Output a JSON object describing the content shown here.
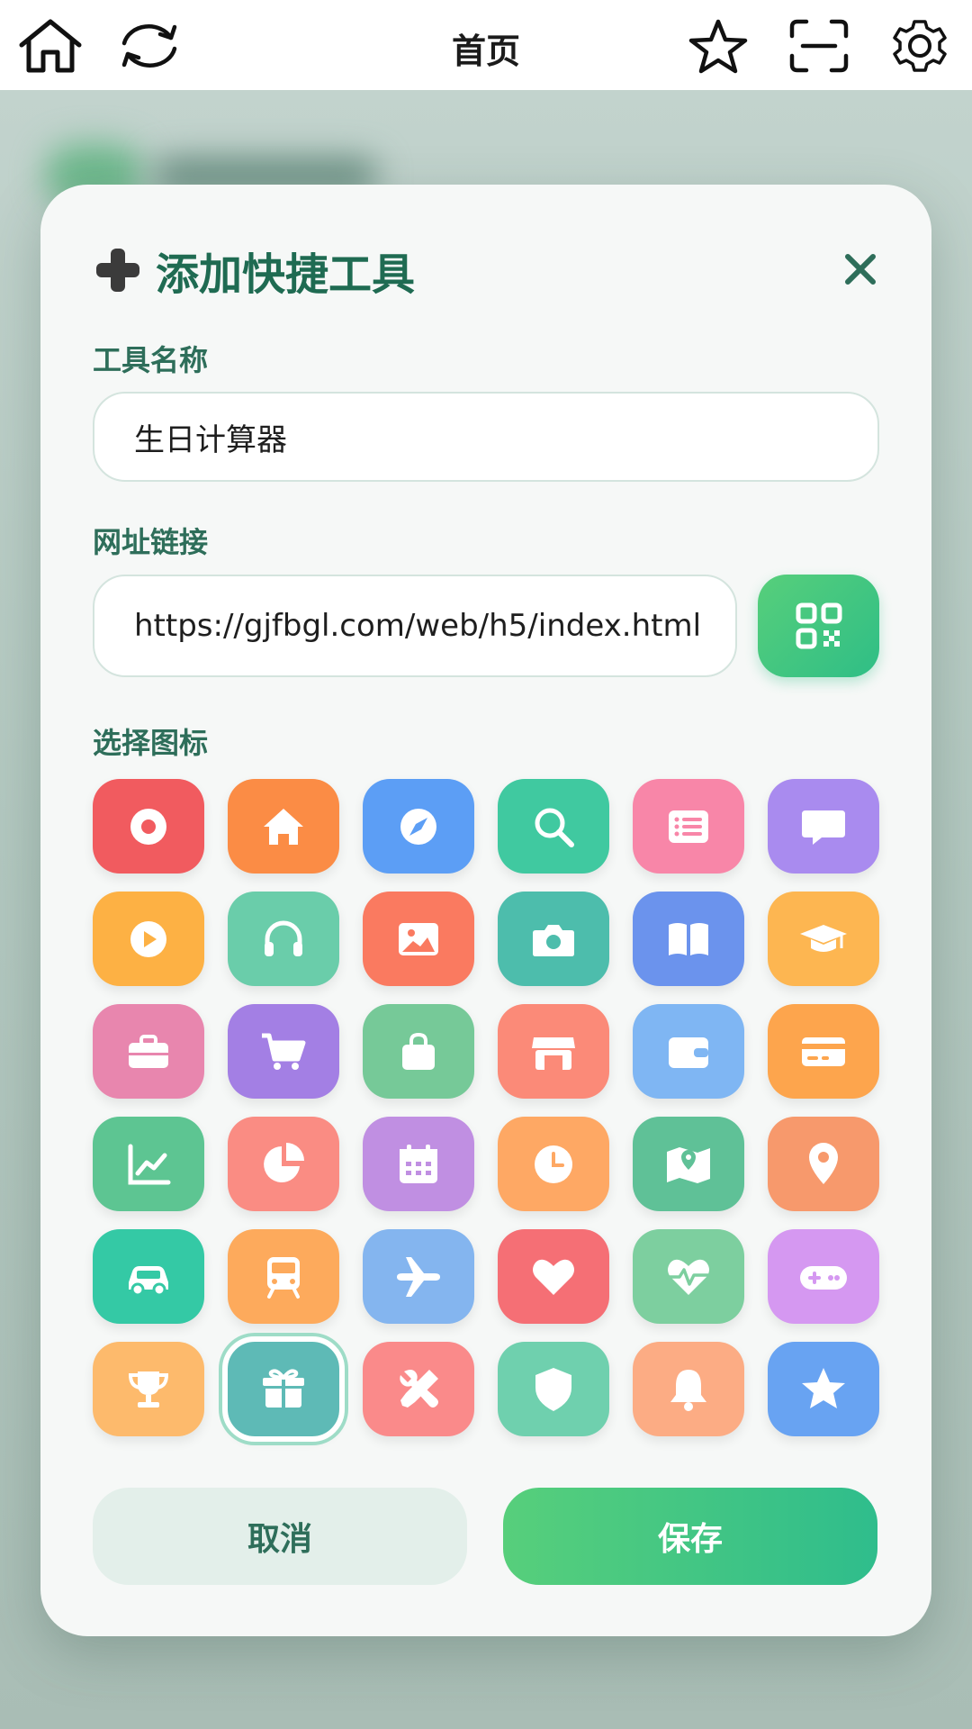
{
  "topbar": {
    "title": "首页",
    "icons": [
      "home-icon",
      "refresh-icon",
      "star-outline-icon",
      "scan-icon",
      "gear-icon"
    ]
  },
  "dialog": {
    "title": "添加快捷工具",
    "title_icon": "plus-icon",
    "close_icon": "close-icon",
    "name_label": "工具名称",
    "name_value": "生日计算器",
    "url_label": "网址链接",
    "url_value": "https://gjfbgl.com/web/h5/index.html",
    "qr_icon": "qr-code-icon",
    "icon_label": "选择图标",
    "icons": [
      {
        "name": "record",
        "color": "#f15b5f"
      },
      {
        "name": "home",
        "color": "#fb8c45"
      },
      {
        "name": "compass",
        "color": "#5c9ef5"
      },
      {
        "name": "search",
        "color": "#40c9a0"
      },
      {
        "name": "list",
        "color": "#f886a8"
      },
      {
        "name": "chat",
        "color": "#a98bef"
      },
      {
        "name": "play",
        "color": "#fdb144"
      },
      {
        "name": "headphones",
        "color": "#6acdaa"
      },
      {
        "name": "image",
        "color": "#fa7a60"
      },
      {
        "name": "camera",
        "color": "#4dbdac"
      },
      {
        "name": "book",
        "color": "#6b93ed"
      },
      {
        "name": "graduation-cap",
        "color": "#fdb651"
      },
      {
        "name": "briefcase",
        "color": "#e886ae"
      },
      {
        "name": "cart",
        "color": "#a37fe4"
      },
      {
        "name": "bag",
        "color": "#76c998"
      },
      {
        "name": "store",
        "color": "#fb8a78"
      },
      {
        "name": "wallet",
        "color": "#7fb6f3"
      },
      {
        "name": "credit-card",
        "color": "#fda54d"
      },
      {
        "name": "chart-line",
        "color": "#5dc592"
      },
      {
        "name": "pie-chart",
        "color": "#fa8c83"
      },
      {
        "name": "calendar",
        "color": "#c08fe2"
      },
      {
        "name": "clock",
        "color": "#fea864"
      },
      {
        "name": "map",
        "color": "#5fc197"
      },
      {
        "name": "location-pin",
        "color": "#f7996c"
      },
      {
        "name": "car",
        "color": "#34c9a5"
      },
      {
        "name": "bus",
        "color": "#fdaa5c"
      },
      {
        "name": "plane",
        "color": "#84b5ef"
      },
      {
        "name": "heart",
        "color": "#f56f75"
      },
      {
        "name": "heartbeat",
        "color": "#7dcf9f"
      },
      {
        "name": "gamepad",
        "color": "#d598f1"
      },
      {
        "name": "trophy",
        "color": "#fdba6c"
      },
      {
        "name": "gift",
        "color": "#5ebab6",
        "selected": true
      },
      {
        "name": "tools",
        "color": "#fa8a8a"
      },
      {
        "name": "shield",
        "color": "#6fd0ae"
      },
      {
        "name": "bell",
        "color": "#fcac84"
      },
      {
        "name": "star",
        "color": "#68a3f2"
      }
    ],
    "cancel_label": "取消",
    "save_label": "保存"
  },
  "colors": {
    "accent": "#2fbe86",
    "title_text": "#1f6b52",
    "label_text": "#2e6e5a"
  }
}
